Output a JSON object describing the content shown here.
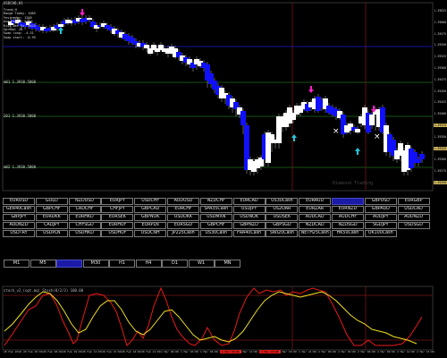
{
  "chart": {
    "title": "USDCAD,H1",
    "info": [
      "Trend_H",
      "Range Today: 1065",
      "Yesterday: 1200",
      "Avg Range: 1164",
      "Risk Dec Ex: 3625",
      "Spread: 28",
      "Swap long: -4.31",
      "Swap short: -0.95"
    ],
    "levels": [
      "m01 1.3930.5000",
      "201 1.3930.5000",
      "m02 1.3930.5000"
    ],
    "watermark": "Diamond Trading",
    "price_labels": [
      "1.39625",
      "1.39600",
      "1.39575",
      "1.39550",
      "1.39525",
      "1.39500",
      "1.39475",
      "1.39450",
      "1.39425",
      "1.39400",
      "1.39375",
      "1.39350",
      "1.39325",
      "1.39300",
      "1.39275",
      "1.39250"
    ],
    "highlighted_prices": [
      "1.39375",
      "1.39325",
      "1.39250"
    ],
    "colors": {
      "bull": "#ffffff",
      "bear": "#1010ff",
      "buy_arrow": "#22c8d8",
      "sell_arrow": "#ff1ec8",
      "level_line": "#1f6e1f",
      "vline": "#7a1414",
      "hline_blue": "#1414a0"
    }
  },
  "symbols": [
    "EURUSD",
    "GOLD",
    "NZDUSD",
    "EURJPY",
    "USDCHF",
    "AUDUSD",
    "NZDCHF",
    "EURCAD",
    "US30Cash",
    "EURAUD",
    "USDCAD",
    "GBPUSD",
    "EURGBP",
    "GER40Cash",
    "GBPCHF",
    "CADCHF",
    "CHFJPY",
    "GBPCAD",
    "EURCHF",
    "SPA35Cash",
    "USDJPY",
    "US2OAR",
    "EURZAR",
    "EURNZD",
    "GBPAUD",
    "USDCAD",
    "GBPJPY",
    "EURDKK",
    "EURHKD",
    "EURSEK",
    "GBPNOK",
    "USDDKK",
    "USDMXN",
    "USDNOK",
    "USDSEK",
    "AUDCAD",
    "AUDCHF",
    "AUDJPY",
    "AUDNZD",
    "AUDNZD",
    "CADJPY",
    "CHFSGD",
    "EURHUF",
    "EURPLN",
    "EURSGD",
    "GBPCHF",
    "GBPNZD",
    "GBPSGD",
    "NZDCAD",
    "NZDSGD",
    "SGDJPY",
    "USDSGD",
    "USDTRY",
    "USDPLN",
    "USDHKD",
    "USDHUF",
    "USDCNH",
    "JP225Cash",
    "US30Cash",
    "FRA40Cash",
    "SWI20Cash",
    "NETH25Cash",
    "HK50Cash",
    "UK100Cash"
  ],
  "active_symbol_index": 10,
  "timeframes": [
    "M1",
    "M5",
    "M15",
    "M30",
    "H1",
    "H4",
    "D1",
    "W1",
    "MN"
  ],
  "active_timeframe_index": 2,
  "indicator": {
    "label": "stoch_v2_(opt.mq) Stoch(8/2/3) 100.00",
    "colors": {
      "line1": "#e81a1a",
      "line2": "#f0e020",
      "level": "#7a1818"
    }
  },
  "time_labels": [
    "28 Feb 2018",
    "28 Feb 05:00",
    "28 Feb 08:00",
    "28 Feb 09:00",
    "28 Feb 12:00",
    "28 Feb 15:00",
    "28 Feb 18:00",
    "28 Feb 21:00",
    "1 Mar 00:00",
    "1 Mar 03:00",
    "1 Mar 06:00",
    "1 Mar 09:00",
    "1 Mar 12:00",
    "1 Mar 15:00",
    "1 Mar 18:00",
    "1 Mar 21:00",
    "2 Mar 00:00",
    "2 Mar 03:00",
    "2 Mar 06:00",
    "2 Mar 09:00",
    "2 Mar 12:00",
    "2 Mar 15:00"
  ],
  "time_labels_red": [
    11,
    13
  ]
}
